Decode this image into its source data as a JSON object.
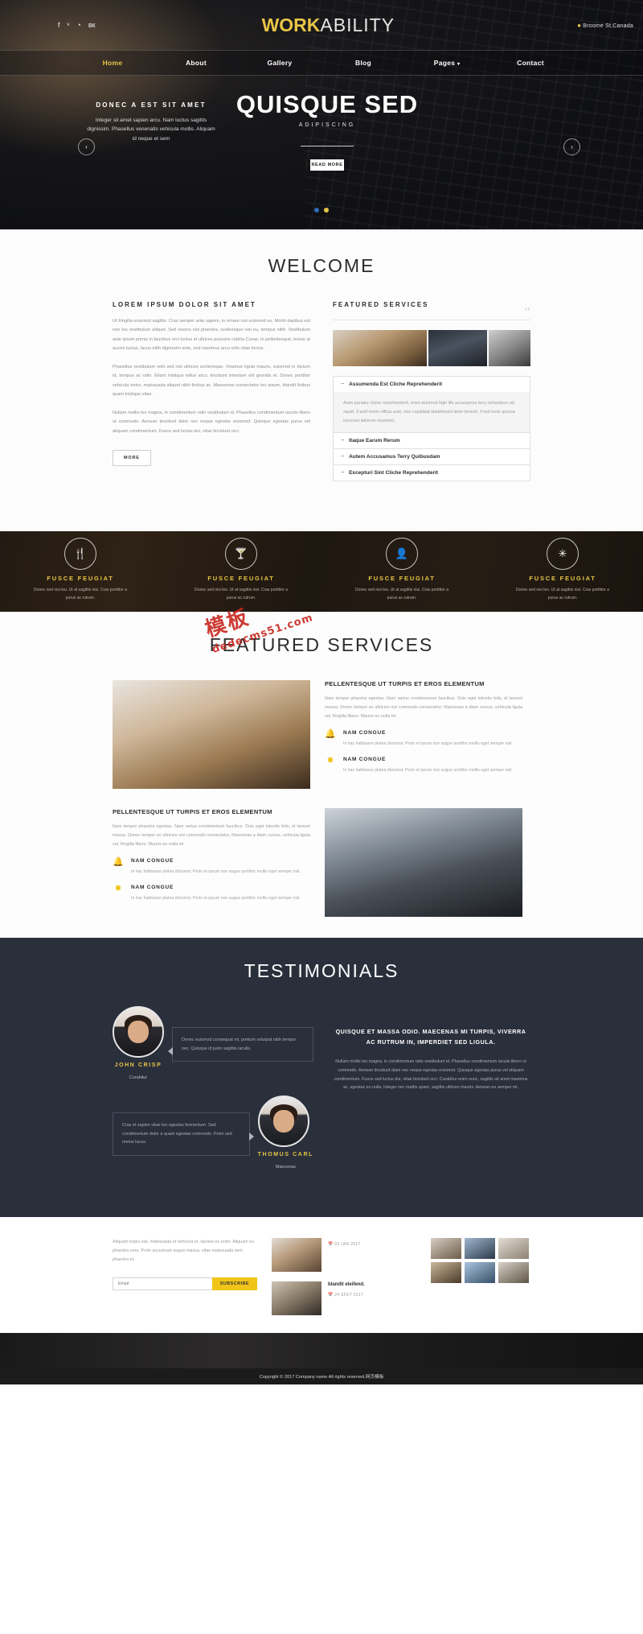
{
  "header": {
    "social": [
      "f",
      "ᵛ",
      "◔",
      "вк"
    ],
    "brand_strong": "WORK",
    "brand_light": "ABILITY",
    "location": "Broome St,Canada",
    "location_icon": "map-pin-icon",
    "nav": [
      {
        "label": "Home",
        "active": true
      },
      {
        "label": "About",
        "active": false
      },
      {
        "label": "Gallery",
        "active": false
      },
      {
        "label": "Blog",
        "active": false
      },
      {
        "label": "Pages",
        "active": false,
        "caret": "▾"
      },
      {
        "label": "Contact",
        "active": false
      }
    ]
  },
  "slider": {
    "left_title": "DONEC A EST SIT AMET",
    "left_text": "Integer sit amet sapien arcu. Nam luctus sagittis dignissim. Phasellus venenatis vehicula mollis. Aliquam id neque et sem",
    "main_title": "QUISQUE SED",
    "sub_title": "ADIPISCING",
    "read_more": "READ MORE",
    "prev": "‹",
    "next": "›"
  },
  "welcome": {
    "heading": "WELCOME",
    "left_title": "LOREM IPSUM DOLOR SIT AMET",
    "paragraphs": [
      "Ut fringilla euismod sagittis. Cras semper ante sapien, in ornare nisi euismod eu. Morbi dapibus est non leo vestibulum aliquet. Sed viverra nisi pharetra, scelerisque nisi eu, tempus nibh. Vestibulum ante ipsum primis in faucibus orci luctus et ultrices posuere cubilia Curae; In pellentesque, lectus at auctor luctus, lacus nibh dignissim ante, sed maximus arcu odio vitae lectus.",
      "Phasellus vestibulum velit sed nisi ultrices scelerisque. Vivamus ligula mauris, euismod in dictum id, tempus ac odio. Etiam tristique tellus arcu, tincidunt interdum elit gravida et. Donec porttitor vehicula tortor, malesuada aliquet nibh finibus ac. Maecenas consectetur leo ipsum, blandit finibus quam tristique vitae.",
      "Nullam mollis leo magna, in condimentum odio vestibulum id. Phasellus condimentum iaculis libero ut commodo. Aenean tincidunt diam nec neque egestas euismod. Quisque egestas purus vel aliquam condimentum. Fusce sed luctus dui, vitae tincidunt orci."
    ],
    "more_label": "MORE",
    "featured_title": "FEATURED SERVICES",
    "featured_nav": "‹›",
    "accordion": [
      {
        "title": "Assumenda Est Cliche Reprehenderit",
        "open": true,
        "body": "Anim pariatur cliche reprehenderit, enim eiusmod high life accusamus terry richardson ad squid. 3 wolf moon officia aute, non cupidatat skateboard dolor brunch. Food truck quinoa nesciunt laborum eiusmod."
      },
      {
        "title": "Itaque Earum Rerum",
        "open": false,
        "body": ""
      },
      {
        "title": "Autem Accusamus Terry Quibusdam",
        "open": false,
        "body": ""
      },
      {
        "title": "Excepturi Sint Cliche Reprehenderit",
        "open": false,
        "body": ""
      }
    ]
  },
  "iconband": {
    "items": [
      {
        "icon": "fork-knife-icon",
        "glyph": "🍴",
        "title": "FUSCE FEUGIAT",
        "text": "Donec sed nisi leo. Ut at sagittis nisi. Cras porttitor a purus ac rutrum."
      },
      {
        "icon": "cocktail-glass-icon",
        "glyph": "🍸",
        "title": "FUSCE FEUGIAT",
        "text": "Donec sed nisi leo. Ut at sagittis nisi. Cras porttitor a purus ac rutrum."
      },
      {
        "icon": "user-icon",
        "glyph": "👤",
        "title": "FUSCE FEUGIAT",
        "text": "Donec sed nisi leo. Ut at sagittis nisi. Cras porttitor a purus ac rutrum."
      },
      {
        "icon": "asterisk-icon",
        "glyph": "✳",
        "title": "FUSCE FEUGIAT",
        "text": "Donec sed nisi leo. Ut at sagittis nisi. Cras porttitor a purus ac rutrum."
      }
    ]
  },
  "watermark": {
    "line1": "模板",
    "line2": "dedecms51.com"
  },
  "features": {
    "heading": "FEATURED SERVICES",
    "block1": {
      "title": "PELLENTESQUE UT TURPIS ET EROS ELEMENTUM",
      "text": "Nam tempor pharetra egestas. Nam varius condimentum faucibus. Duis eget lobortis felis, id laoreet massa. Donec tempor ex ultricies nisi commodo consectetur. Maecenas a diam cursus, vehicula ligula vel, fringilla libero. Mauris eu nulla mi.",
      "items": [
        {
          "icon": "bell-icon",
          "glyph": "🔔",
          "title": "NAM CONGUE",
          "text": "In hac habitasse platea dictumst. Proin et ipsum non augue porttitor mollis eget semper nisl."
        },
        {
          "icon": "star-icon",
          "glyph": "✸",
          "title": "NAM CONGUE",
          "text": "In hac habitasse platea dictumst. Proin et ipsum non augue porttitor mollis eget semper nisl."
        }
      ]
    },
    "block2": {
      "title": "PELLENTESQUE UT TURPIS ET EROS ELEMENTUM",
      "text": "Nam tempor pharetra egestas. Nam varius condimentum faucibus. Duis eget lobortis felis, id laoreet massa. Donec tempor ex ultricies nisi commodo consectetur. Maecenas a diam cursus, vehicula ligula vel, fringilla libero. Mauris eu nulla mi.",
      "items": [
        {
          "icon": "bell-icon",
          "glyph": "🔔",
          "title": "NAM CONGUE",
          "text": "In hac habitasse platea dictumst. Proin et ipsum non augue porttitor mollis eget semper nisl."
        },
        {
          "icon": "star-icon",
          "glyph": "✸",
          "title": "NAM CONGUE",
          "text": "In hac habitasse platea dictumst. Proin et ipsum non augue porttitor mollis eget semper nisl."
        }
      ]
    }
  },
  "testimonials": {
    "heading": "TESTIMONIALS",
    "people": [
      {
        "name": "JOHN CRISP",
        "role": "Curabitur",
        "quote": "Donec euismod consequat mi, pretium volutpat nibh tempor nec. Quisque id justo sagittis iaculis."
      },
      {
        "name": "THOMUS CARL",
        "role": "Maecenas",
        "quote": "Cras et sapien vitae leo egestas fermentum. Sed condimentum dolor a quam egestas commodo. Proin sed metus lacus."
      }
    ],
    "right_title": "QUISQUE ET MASSA ODIO. MAECENAS MI TURPIS, VIVERRA AC RUTRUM IN, IMPERDIET SED LIGULA.",
    "right_text": "Nullam mollis leo magna, in condimentum odio vestibulum id. Phasellus condimentum iaculis libero ut commodo. Aenean tincidunt diam nec neque egestas euismod. Quisque egestas purus vel aliquam condimentum. Fusce sed luctus dui, vitae tincidunt orci. Curabitur enim nunc, sagittis sit amet maximus ac, egestas eu nulla. Integer nec mattis quam, sagittis ultrices mauris. Aenean eu semper mi."
  },
  "footer": {
    "about_text": "Aliquam turpis nisl, malesuada et vehicula et, laoreet eu enim. Aliquam eu pharetra urna. Proin accumsan augue massa, vitae malesuada sem pharetra et.",
    "email_placeholder": "Email",
    "subscribe_label": "SUBSCRIBE",
    "posts": [
      {
        "title": "",
        "date": "03 JAN 2017",
        "date_icon": "calendar-icon"
      },
      {
        "title": "blandit eleifend.",
        "date": "24 SFET 2017",
        "date_icon": "calendar-icon"
      }
    ],
    "gallery_count": 6,
    "copyright": "Copyright © 2017 Company name All rights reserved.网页模板"
  }
}
